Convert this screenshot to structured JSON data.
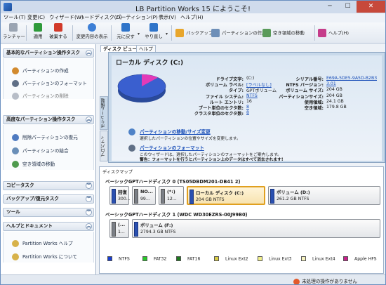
{
  "window": {
    "title": "LB Partition Works 15 にようこそ!",
    "buttons": {
      "minimize": "─",
      "maximize": "☐",
      "close": "✕"
    }
  },
  "menu": [
    "ツール(T)",
    "変更(C)",
    "ウィザード(W)",
    "ハードディスク(D)",
    "パーティション(P)",
    "表示(V)",
    "ヘルプ(H)"
  ],
  "toolbar": {
    "launcher": "ランチャー",
    "apply": "適用",
    "discard": "破棄する",
    "show_changes": "変更内容の表示",
    "undo": "元に戻す",
    "redo": "やり直し",
    "backup": "バックアップ",
    "create_partition": "パーティションの作成",
    "move_free_space": "空き領域の移動",
    "help": "ヘルプ(H)"
  },
  "sidebar": {
    "sections": [
      {
        "title": "基本的なパーティション操作タスク",
        "items": [
          "パーティションの作成",
          "パーティションのフォーマット",
          "パーティションの削除"
        ]
      },
      {
        "title": "高度なパーティション操作タスク",
        "items": [
          "削除パーティションの復元",
          "パーティションの結合",
          "空き領域の移動"
        ]
      },
      {
        "title": "コピータスク"
      },
      {
        "title": "バックアップ/復元タスク"
      },
      {
        "title": "ツール"
      },
      {
        "title": "ヘルプとドキュメント",
        "items": [
          "Partition Works ヘルプ",
          "Partition Works について"
        ]
      }
    ]
  },
  "tabs": [
    "ディスク ビュー",
    "ヘルプ"
  ],
  "vtabs": [
    "ボリューム情報",
    "プロパティ"
  ],
  "volume": {
    "title": "ローカル ディスク (C:)",
    "left": [
      {
        "k": "ドライブ文字:",
        "v": "(C:)"
      },
      {
        "k": "ボリューム ラベル:",
        "v": "[ラベルなし]"
      },
      {
        "k": "タイプ:",
        "v": "GPTボリューム"
      },
      {
        "k": "ファイル システム:",
        "v": "NTFS"
      },
      {
        "k": "ルート エントリ:",
        "v": "16"
      },
      {
        "k": "ブート単位のセクタ数:",
        "v": "8"
      },
      {
        "k": "クラスタ単位のセクタ数:",
        "v": "8"
      }
    ],
    "right": [
      {
        "k": "シリアル番号:",
        "v": "E69A-5DE5-9A5D-B2B3"
      },
      {
        "k": "NTFS バージョン:",
        "v": "3.01"
      },
      {
        "k": "ボリューム サイズ:",
        "v": "204 GB"
      },
      {
        "k": "パーティションサイズ:",
        "v": "204 GB"
      },
      {
        "k": "使用領域:",
        "v": "24.1 GB"
      },
      {
        "k": "空き領域:",
        "v": "179.8 GB"
      }
    ],
    "usage_fraction": 0.118
  },
  "hints": [
    {
      "title": "パーティションの移動/サイズ変更",
      "text": "選択したパーティションの位置やサイズを変更します。"
    },
    {
      "title": "パーティションのフォーマット",
      "text1": "このウィザードは、選択したパーティションのフォーマットをご案内します。",
      "text2": "警告：フォーマットを行うとパーティション上のデータはすべて消去されます!"
    }
  ],
  "diskmap": {
    "title": "ディスクマップ",
    "disks": [
      {
        "header": "ベーシックGPTハードディスク 0 (TS05DBDM201-DB41 2)",
        "partitions": [
          {
            "name": "回復",
            "info": "300...",
            "color": "blue"
          },
          {
            "name": "NO...",
            "info": "99...",
            "color": "gray"
          },
          {
            "name": "(*:)",
            "info": "12...",
            "color": "gray"
          },
          {
            "name": "ローカル ディスク (C:)",
            "info": "204 GB NTFS",
            "color": "blue",
            "selected": true
          },
          {
            "name": "ボリューム (D:)",
            "info": "261.2 GB NTFS",
            "color": "blue"
          }
        ]
      },
      {
        "header": "ベーシックGPTハードディスク 1 (WDC WD30EZRS-00J99B0)",
        "partitions": [
          {
            "name": "(...",
            "info": "1...",
            "color": "gray"
          },
          {
            "name": "ボリューム (F:)",
            "info": "2794.3 GB NTFS",
            "color": "blue"
          }
        ]
      }
    ]
  },
  "legend": [
    {
      "label": "NTFS",
      "color": "#1a3fd0"
    },
    {
      "label": "FAT32",
      "color": "#29c829"
    },
    {
      "label": "FAT16",
      "color": "#1f7a1f"
    },
    {
      "label": "Linux Ext2",
      "color": "#d8cc45"
    },
    {
      "label": "Linux Ext3",
      "color": "#f2f08a"
    },
    {
      "label": "Linux Ext4",
      "color": "#f7f3c0"
    },
    {
      "label": "Apple HFS",
      "color": "#c8208c"
    }
  ],
  "status": "未処理の操作がありません"
}
